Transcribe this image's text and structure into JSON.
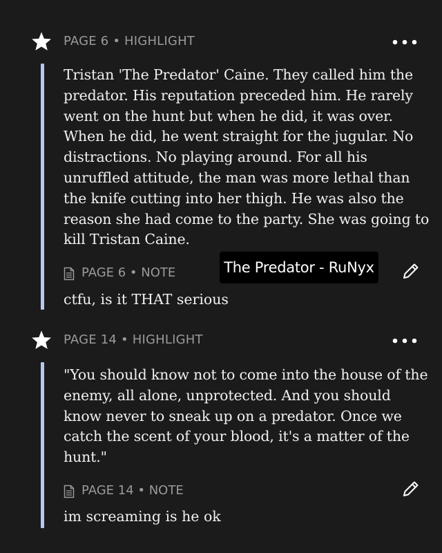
{
  "entries": [
    {
      "meta": "PAGE 6 • HIGHLIGHT",
      "highlight": "Tristan 'The Predator' Caine. They called him the predator. His reputation preceded him. He rarely went on the hunt but when he did, it was over. When he did, he went straight for the jugular. No distractions. No playing around. For all his unruffled attitude, the man was more lethal than the knife cutting into her thigh. He was also the reason she had come to the party. She was going to kill Tristan Caine.",
      "note_label": "PAGE 6 • NOTE",
      "note": "ctfu, is it THAT serious"
    },
    {
      "meta": "PAGE 14 • HIGHLIGHT",
      "highlight": "\"You should know not to come into the house of the enemy, all alone, unprotected. And you should know never to sneak up on a predator. Once we catch the scent of your blood, it's a matter of the hunt.\"",
      "note_label": "PAGE 14 • NOTE",
      "note": "im screaming is he ok"
    }
  ],
  "watermark": "The Predator - RuNyx",
  "colors": {
    "background": "#1b1b1b",
    "highlight_bar": "#b8c6f2",
    "meta_text": "#9a9a9a"
  },
  "icons": {
    "star": "star-icon",
    "more": "more-horizontal-icon",
    "note": "note-document-icon",
    "edit": "pencil-edit-icon"
  }
}
